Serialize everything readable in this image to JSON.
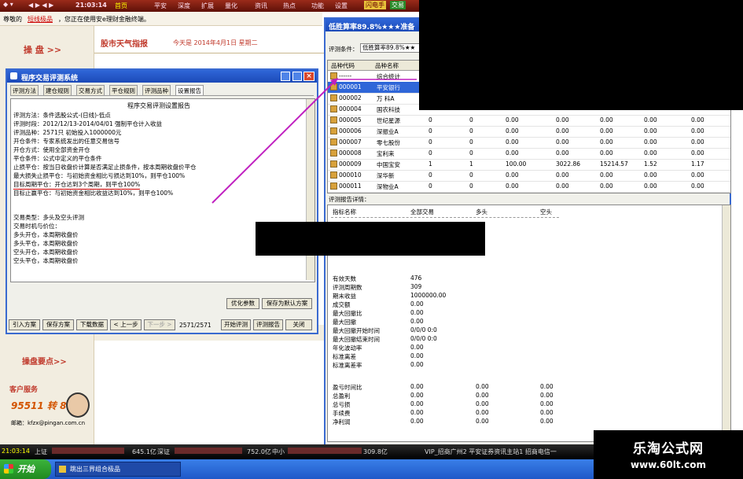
{
  "topbar": {
    "time": "21:03:14",
    "menu": [
      "首页",
      "平安",
      "深度",
      "扩展",
      "量化",
      "资讯",
      "热点",
      "功能",
      "设置"
    ],
    "right_buttons": [
      "闪电手",
      "交易"
    ]
  },
  "ticker": {
    "text1": "尊敬的",
    "highlight": "短线极品",
    "text2": "，您正在使用安e理财金融终端。"
  },
  "sidebar": {
    "panpan": "操 盘 >>",
    "yaodian": "操盘要点>>",
    "service_title": "客户服务",
    "phone": "95511 转 8",
    "email": "邮箱：kfzx@pingan.com.cn"
  },
  "main": {
    "weather": "股市天气指报",
    "today": "今天是  2014年4月1日  星期二"
  },
  "eval_window": {
    "title": "程序交易评测系统",
    "tabs": [
      "评测方法",
      "建仓规则",
      "交易方式",
      "平仓规则",
      "评测品种",
      "设置报告"
    ],
    "report_title": "程序交易评测设置报告",
    "lines": [
      "评测方法：条件选股公式-(日线)-低点",
      "评测时段：2012/12/13-2014/04/01  强制平仓计入收益",
      "评测品种：2571只  初始投入1000000元",
      "开仓条件：专家系统发出的任意交易信号",
      "开仓方式：使用全部资金开仓",
      "平仓条件：公式中定义的平仓条件",
      "止损平仓：按当日收盘价计算是否满足止损条件，按本周期收盘价平仓",
      "        最大损失止损平仓：与初始资金相比亏损达到10%，则平仓100%",
      "        目标周期平仓：开仓达到3个周期，则平仓100%",
      "        目标止赢平仓：与初始资金相比收益达到10%，则平仓100%",
      "",
      "交易类型：多头及空头评测",
      "交易时机与价位：",
      "        多头开仓，本周期收盘价",
      "        多头平仓，本周期收盘价",
      "        空头开仓，本周期收盘价",
      "        空头平仓，本周期收盘价"
    ],
    "btn_optimize": "优化参数",
    "btn_save_default": "保存为默认方案",
    "btn_import": "引入方案",
    "btn_save": "保存方案",
    "btn_download": "下载数据",
    "btn_prev": "< 上一步",
    "btn_next": "下一步 >",
    "progress": "2571/2571",
    "btn_start": "开始评测",
    "btn_report": "评测报告",
    "btn_close": "关闭"
  },
  "result_window": {
    "title": "低胜算率89.8%★★★准备",
    "cond_label": "评测条件：",
    "cond_value": "低胜算率89.8%★★",
    "headers": [
      "品种代码",
      "品种名称"
    ],
    "rows": [
      [
        "------",
        "综合统计"
      ],
      [
        "000001",
        "平安银行"
      ],
      [
        "000002",
        "万 科A"
      ],
      [
        "000004",
        "国农科技"
      ],
      [
        "000005",
        "世纪星源"
      ],
      [
        "000006",
        "深振业A"
      ],
      [
        "000007",
        "零七股份"
      ],
      [
        "000008",
        "宝利来"
      ],
      [
        "000009",
        "中国宝安"
      ],
      [
        "000010",
        "深华新"
      ],
      [
        "000011",
        "深物业A"
      ]
    ],
    "row_values": [
      [],
      [],
      [],
      [],
      [
        "0",
        "0",
        "0.00",
        "0.00",
        "0.00",
        "0.00",
        "0.00"
      ],
      [
        "0",
        "0",
        "0.00",
        "0.00",
        "0.00",
        "0.00",
        "0.00"
      ],
      [
        "0",
        "0",
        "0.00",
        "0.00",
        "0.00",
        "0.00",
        "0.00"
      ],
      [
        "0",
        "0",
        "0.00",
        "0.00",
        "0.00",
        "0.00",
        "0.00"
      ],
      [
        "1",
        "1",
        "100.00",
        "3022.86",
        "15214.57",
        "1.52",
        "1.17"
      ],
      [
        "0",
        "0",
        "0.00",
        "0.00",
        "0.00",
        "0.00",
        "0.00"
      ],
      [
        "0",
        "0",
        "0.00",
        "0.00",
        "0.00",
        "0.00",
        "0.00"
      ]
    ],
    "detail_label": "评测报告详情：",
    "detail_headers": [
      "指标名称",
      "全部交易",
      "多头",
      "空头"
    ],
    "detail_rows": [
      [
        "有效天数",
        "476",
        "",
        ""
      ],
      [
        "评测周期数",
        "309",
        "",
        ""
      ],
      [
        "期末收益",
        "1000000.00",
        "",
        ""
      ],
      [
        "成交额",
        "0.00",
        "",
        ""
      ],
      [
        "最大回撤比",
        "0.00",
        "",
        ""
      ],
      [
        "最大回撤",
        "0.00",
        "",
        ""
      ],
      [
        "最大回撤开始时间",
        "0/0/0 0:0",
        "",
        ""
      ],
      [
        "最大回撤结束时间",
        "0/0/0 0:0",
        "",
        ""
      ],
      [
        "年化波动率",
        "0.00",
        "",
        ""
      ],
      [
        "标准离差",
        "0.00",
        "",
        ""
      ],
      [
        "标准离差率",
        "0.00",
        "",
        ""
      ],
      [
        "",
        "",
        "",
        ""
      ],
      [
        "盈亏时间比",
        "0.00",
        "0.00",
        "0.00"
      ],
      [
        "总盈利",
        "0.00",
        "0.00",
        "0.00"
      ],
      [
        "总亏损",
        "0.00",
        "0.00",
        "0.00"
      ],
      [
        "手续费",
        "0.00",
        "0.00",
        "0.00"
      ],
      [
        "净利润",
        "0.00",
        "0.00",
        "0.00"
      ]
    ]
  },
  "statusbar": {
    "time": "21:03:14",
    "sh": "上证",
    "v1": "645.1亿",
    "sz": "深证",
    "v2": "752.0亿",
    "zx": "中小",
    "v3": "309.8亿",
    "news": "VIP_招商广州2  平安证券资讯主站1  招商电信一"
  },
  "taskbar": {
    "start": "开始",
    "task": "跳出三界组合极品"
  },
  "watermark": {
    "cn": "乐淘公式网",
    "url": "www.60lt.com"
  },
  "colors": {
    "title_blue": "#2f66d8",
    "topbar_red": "#8b2415",
    "highlight_red": "#c00000",
    "selected_row": "#2f66d8"
  }
}
